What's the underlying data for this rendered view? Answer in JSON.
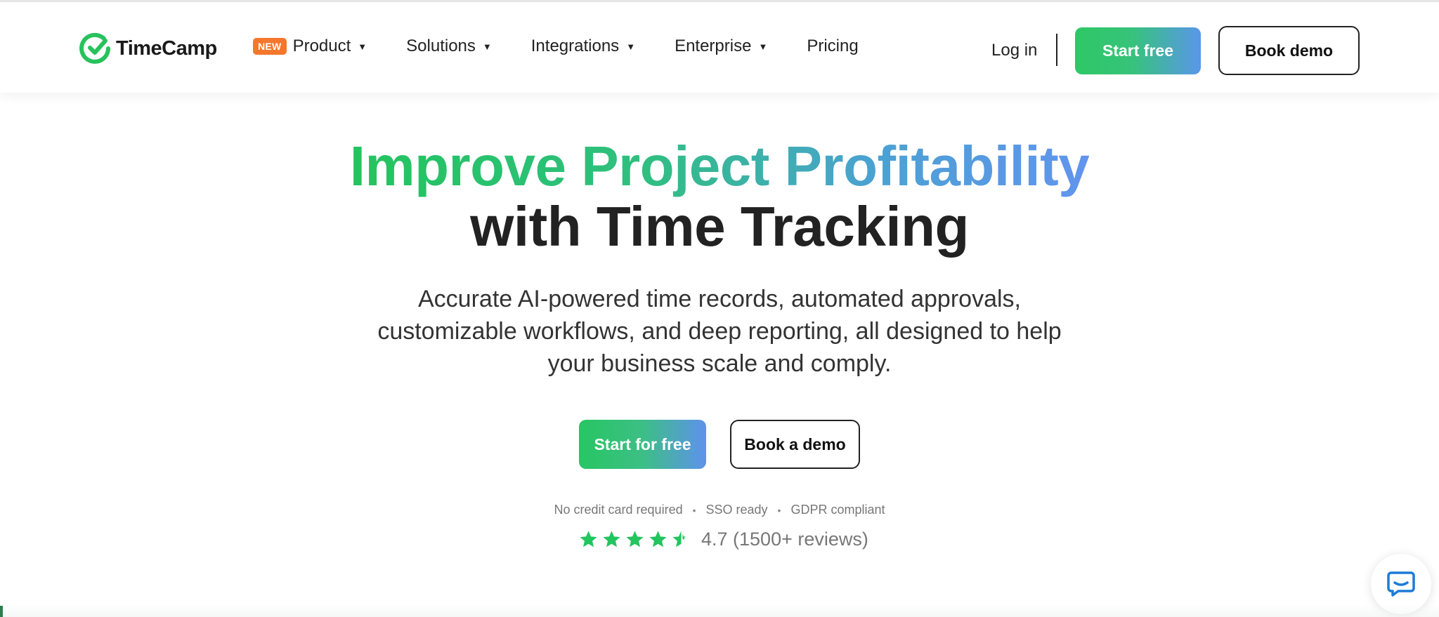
{
  "header": {
    "logo_text": "TimeCamp",
    "nav": [
      {
        "label": "Product",
        "badge": "NEW",
        "has_caret": true
      },
      {
        "label": "Solutions",
        "has_caret": true
      },
      {
        "label": "Integrations",
        "has_caret": true
      },
      {
        "label": "Enterprise",
        "has_caret": true
      },
      {
        "label": "Pricing",
        "has_caret": false
      }
    ],
    "login_label": "Log in",
    "start_free_label": "Start free",
    "book_demo_label": "Book demo"
  },
  "hero": {
    "title_line1": "Improve Project Profitability",
    "title_line2": "with Time Tracking",
    "subtitle": "Accurate AI-powered time records, automated approvals, customizable workflows, and deep reporting, all designed to help your business scale and comply.",
    "cta_primary": "Start for free",
    "cta_secondary": "Book a demo",
    "trust": [
      "No credit card required",
      "SSO ready",
      "GDPR compliant"
    ],
    "rating_value": 4.7,
    "rating_text": "4.7 (1500+ reviews)",
    "stars": 5
  },
  "icons": {
    "logo": "check-circle-icon",
    "caret": "caret-down-icon",
    "star": "star-icon",
    "chat": "chat-bubble-icon"
  },
  "colors": {
    "brand_green": "#2ec866",
    "brand_blue": "#5a96ea",
    "badge_orange": "#f5772b",
    "star_green": "#22c55e",
    "chat_blue": "#1e7bd8"
  }
}
